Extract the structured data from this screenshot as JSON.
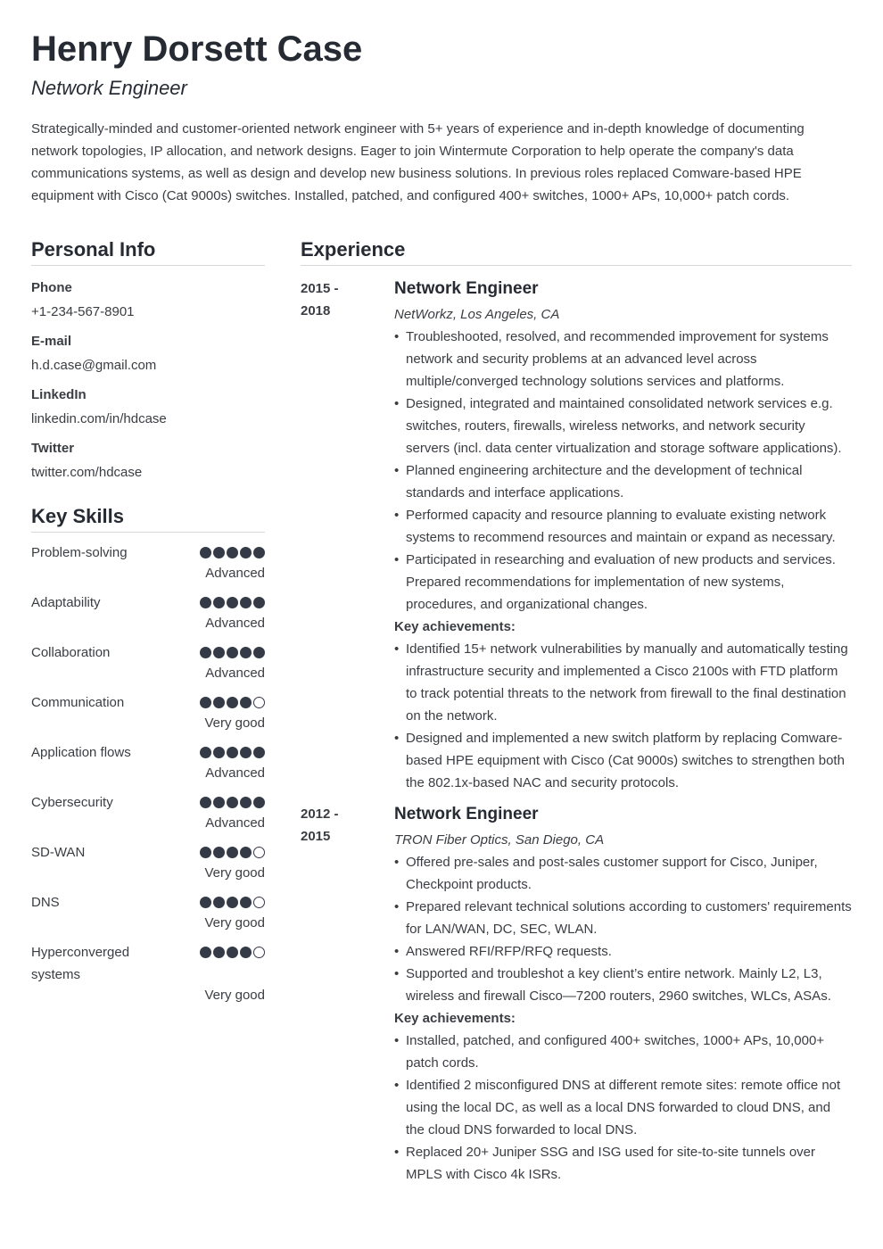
{
  "header": {
    "name": "Henry Dorsett Case",
    "title": "Network Engineer",
    "summary": "Strategically-minded and customer-oriented network engineer with 5+ years of experience and in-depth knowledge of documenting network topologies, IP allocation, and network designs. Eager to join Wintermute Corporation to help operate the company's data communications systems, as well as design and develop new business solutions. In previous roles replaced Comware-based HPE equipment with Cisco (Cat 9000s) switches. Installed, patched, and configured 400+ switches, 1000+ APs, 10,000+ patch cords."
  },
  "personal_info": {
    "heading": "Personal Info",
    "items": [
      {
        "label": "Phone",
        "value": "+1-234-567-8901"
      },
      {
        "label": "E-mail",
        "value": "h.d.case@gmail.com"
      },
      {
        "label": "LinkedIn",
        "value": "linkedin.com/in/hdcase"
      },
      {
        "label": "Twitter",
        "value": "twitter.com/hdcase"
      }
    ]
  },
  "skills": {
    "heading": "Key Skills",
    "max_rating": 5,
    "items": [
      {
        "name": "Problem-solving",
        "rating": 5,
        "level": "Advanced"
      },
      {
        "name": "Adaptability",
        "rating": 5,
        "level": "Advanced"
      },
      {
        "name": "Collaboration",
        "rating": 5,
        "level": "Advanced"
      },
      {
        "name": "Communication",
        "rating": 4,
        "level": "Very good"
      },
      {
        "name": "Application flows",
        "rating": 5,
        "level": "Advanced"
      },
      {
        "name": "Cybersecurity",
        "rating": 5,
        "level": "Advanced"
      },
      {
        "name": "SD-WAN",
        "rating": 4,
        "level": "Very good"
      },
      {
        "name": "DNS",
        "rating": 4,
        "level": "Very good"
      },
      {
        "name": "Hyperconverged systems",
        "rating": 4,
        "level": "Very good"
      }
    ]
  },
  "experience": {
    "heading": "Experience",
    "jobs": [
      {
        "dates": "2015 - 2018",
        "title": "Network Engineer",
        "company": "NetWorkz, Los Angeles, CA",
        "bullets": [
          "Troubleshooted, resolved, and recommended improvement for systems network and security problems at an advanced level across multiple/converged technology solutions services and platforms.",
          "Designed, integrated and maintained consolidated network services e.g. switches, routers, firewalls, wireless networks, and network security servers (incl. data center virtualization and storage software applications).",
          "Planned engineering architecture and the development of technical standards and interface applications.",
          "Performed capacity and resource planning to evaluate existing network systems to recommend resources and maintain or expand as necessary.",
          "Participated in researching and evaluation of new products and services. Prepared recommendations for implementation of new systems, procedures, and organizational changes."
        ],
        "achievements_label": "Key achievements:",
        "achievements": [
          "Identified 15+ network vulnerabilities by manually and automatically testing infrastructure security and implemented a Cisco 2100s with FTD platform to track potential threats to the network from firewall to the final destination on the network.",
          "Designed and implemented a new switch platform by replacing Comware-based HPE equipment with Cisco (Cat 9000s) switches to strengthen both the 802.1x-based NAC and security protocols."
        ]
      },
      {
        "dates": "2012 - 2015",
        "title": "Network Engineer",
        "company": "TRON Fiber Optics, San Diego, CA",
        "bullets": [
          "Offered pre-sales and post-sales customer support for Cisco, Juniper, Checkpoint products.",
          "Prepared relevant technical solutions according to customers' requirements for LAN/WAN, DC, SEC, WLAN.",
          "Answered RFI/RFP/RFQ requests.",
          "Supported and troubleshot a key client’s entire network. Mainly L2, L3, wireless and firewall Cisco—7200 routers, 2960 switches, WLCs, ASAs."
        ],
        "achievements_label": "Key achievements:",
        "achievements": [
          "Installed, patched, and configured 400+ switches, 1000+ APs, 10,000+ patch cords.",
          "Identified 2 misconfigured DNS at different remote sites: remote office not using the local DC, as well as a local DNS forwarded to cloud DNS, and the cloud DNS forwarded to local DNS.",
          "Replaced 20+ Juniper SSG and ISG used for site-to-site tunnels over MPLS with Cisco 4k ISRs."
        ]
      }
    ]
  }
}
